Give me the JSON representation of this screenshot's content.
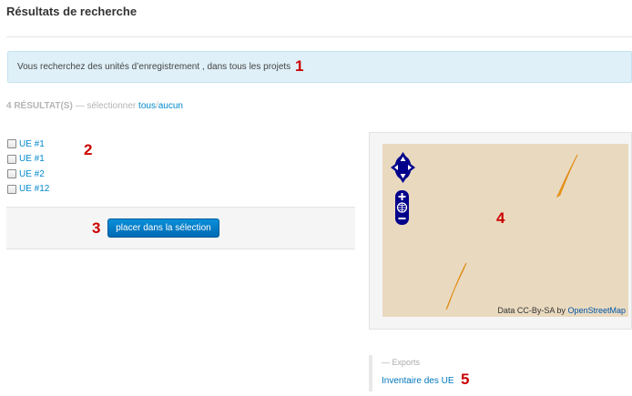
{
  "page_title": "Résultats de recherche",
  "info_message": "Vous recherchez des unités d’enregistrement , dans tous les projets",
  "results": {
    "count_label": "4 RÉSULTAT(S)",
    "select_prefix": "— sélectionner",
    "select_all": "tous",
    "separator": "/",
    "select_none": "aucun"
  },
  "items": [
    {
      "label": "UE #1"
    },
    {
      "label": "UE #1"
    },
    {
      "label": "UE #2"
    },
    {
      "label": "UE #12"
    }
  ],
  "place_button_label": "placer dans la sélection",
  "map": {
    "attribution_prefix": "Data CC-By-SA by",
    "attribution_link": "OpenStreetMap",
    "background_color": "#e9d9bf",
    "feature_color": "#f0a020",
    "control_color": "#00008b"
  },
  "exports": {
    "label": "— Exports",
    "link": "Inventaire des UE"
  },
  "markers": [
    "1",
    "2",
    "3",
    "4",
    "5"
  ],
  "colors": {
    "link": "#0088cc",
    "info_bg": "#dff0f8",
    "button": "#0a7cc9",
    "marker": "#cc0000"
  }
}
